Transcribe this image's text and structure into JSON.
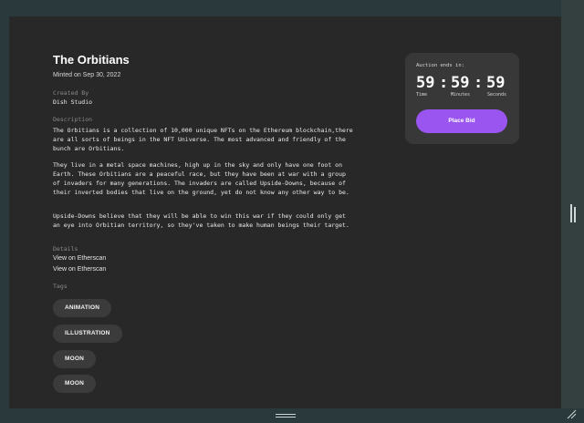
{
  "nft": {
    "title": "The Orbitians",
    "minted": "Minted on Sep 30, 2022",
    "created_by_label": "Created By",
    "creator": "Dish Studio",
    "description_label": "Description",
    "description": [
      "The Orbitians is a collection of 10,000 unique NFTs on the Ethereum blockchain,there are all sorts of beings in the NFT Universe. The most advanced and friendly of the bunch are Orbitians.",
      "They live in a metal space machines, high up in the sky and only have one foot on Earth. These Orbitians are a peaceful race, but they have been at war with a group of invaders for many generations. The invaders are called Upside-Downs, because of their inverted bodies that live on the ground, yet do not know any other way to be.",
      "Upside-Downs believe that they will be able to win this war if they could only get an eye into Orbitian territory, so they've taken to make human beings their target."
    ],
    "details_label": "Details",
    "links": [
      "View on Etherscan",
      "View on Etherscan"
    ],
    "tags_label": "Tags",
    "tags": [
      "ANIMATION",
      "ILLUSTRATION",
      "MOON",
      "MOON"
    ]
  },
  "auction": {
    "label": "Auction ends in:",
    "hours": "59",
    "minutes": "59",
    "seconds": "59",
    "separator": ":",
    "hours_label": "Time",
    "minutes_label": "Minutes",
    "seconds_label": "Seconds",
    "bid_button": "Place Bid",
    "accent_color": "#9a55f0"
  },
  "icons": [
    "resize-grip-right-icon",
    "resize-grip-bottom-icon",
    "resize-corner-icon"
  ]
}
